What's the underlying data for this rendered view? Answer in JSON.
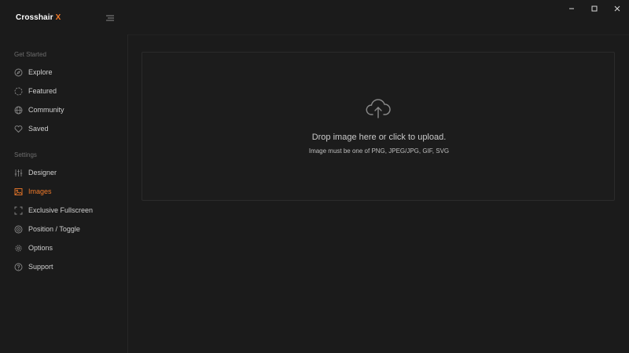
{
  "app": {
    "brand_name": "Crosshair",
    "brand_accent": "X",
    "accent_color": "#f07a2a",
    "menu_icon": "hamburger-icon"
  },
  "window_controls": {
    "minimize_icon": "minimize-icon",
    "maximize_icon": "maximize-icon",
    "close_icon": "close-icon"
  },
  "sidebar": {
    "sections": [
      {
        "label": "Get Started",
        "items": [
          {
            "label": "Explore",
            "icon": "compass-icon",
            "active": false
          },
          {
            "label": "Featured",
            "icon": "spinner-icon",
            "active": false
          },
          {
            "label": "Community",
            "icon": "globe-icon",
            "active": false
          },
          {
            "label": "Saved",
            "icon": "heart-icon",
            "active": false
          }
        ]
      },
      {
        "label": "Settings",
        "items": [
          {
            "label": "Designer",
            "icon": "sliders-icon",
            "active": false
          },
          {
            "label": "Images",
            "icon": "image-icon",
            "active": true
          },
          {
            "label": "Exclusive Fullscreen",
            "icon": "fullscreen-icon",
            "active": false
          },
          {
            "label": "Position / Toggle",
            "icon": "crosshair-target-icon",
            "active": false
          },
          {
            "label": "Options",
            "icon": "gear-icon",
            "active": false
          },
          {
            "label": "Support",
            "icon": "help-circle-icon",
            "active": false
          }
        ]
      }
    ]
  },
  "dropzone": {
    "icon": "cloud-upload-icon",
    "title": "Drop image here or click to upload.",
    "subtitle": "Image must be one of PNG, JPEG/JPG, GIF, SVG"
  }
}
